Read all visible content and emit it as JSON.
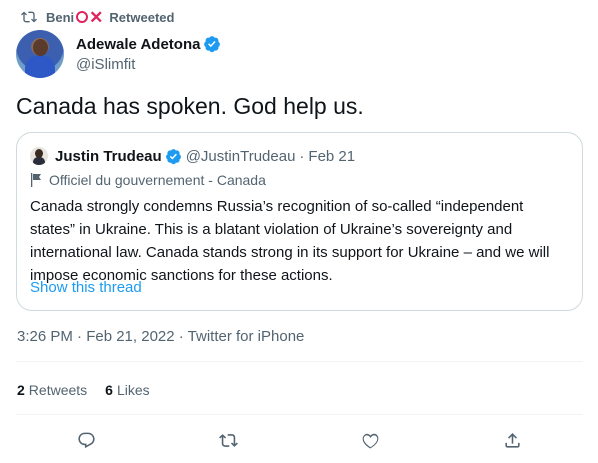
{
  "retweet": {
    "name_prefix": "Beni",
    "label": "Retweeted"
  },
  "author": {
    "display_name": "Adewale Adetona",
    "handle": "@iSlimfit"
  },
  "tweet": {
    "text": "Canada has spoken. God help us."
  },
  "quote": {
    "display_name": "Justin Trudeau",
    "handle": "@JustinTrudeau",
    "separator": "·",
    "date": "Feb 21",
    "label": "Officiel du gouvernement - Canada",
    "text": "Canada strongly condemns Russia’s recognition of so-called “independent states” in Ukraine. This is a blatant violation of Ukraine’s sovereignty and international law. Canada stands strong in its support for Ukraine – and we will impose economic sanctions for these actions.",
    "show_thread": "Show this thread"
  },
  "meta": {
    "text": "3:26 PM · Feb 21, 2022 · Twitter for iPhone"
  },
  "stats": {
    "retweets_count": "2",
    "retweets_label": "Retweets",
    "likes_count": "6",
    "likes_label": "Likes"
  },
  "colors": {
    "accent": "#1d9bf0",
    "secondary_text": "#536471",
    "emoji_red": "#e0245e"
  },
  "icons": [
    "retweet-icon",
    "verified-badge-icon",
    "flag-icon",
    "reply-icon",
    "like-icon",
    "share-icon"
  ]
}
